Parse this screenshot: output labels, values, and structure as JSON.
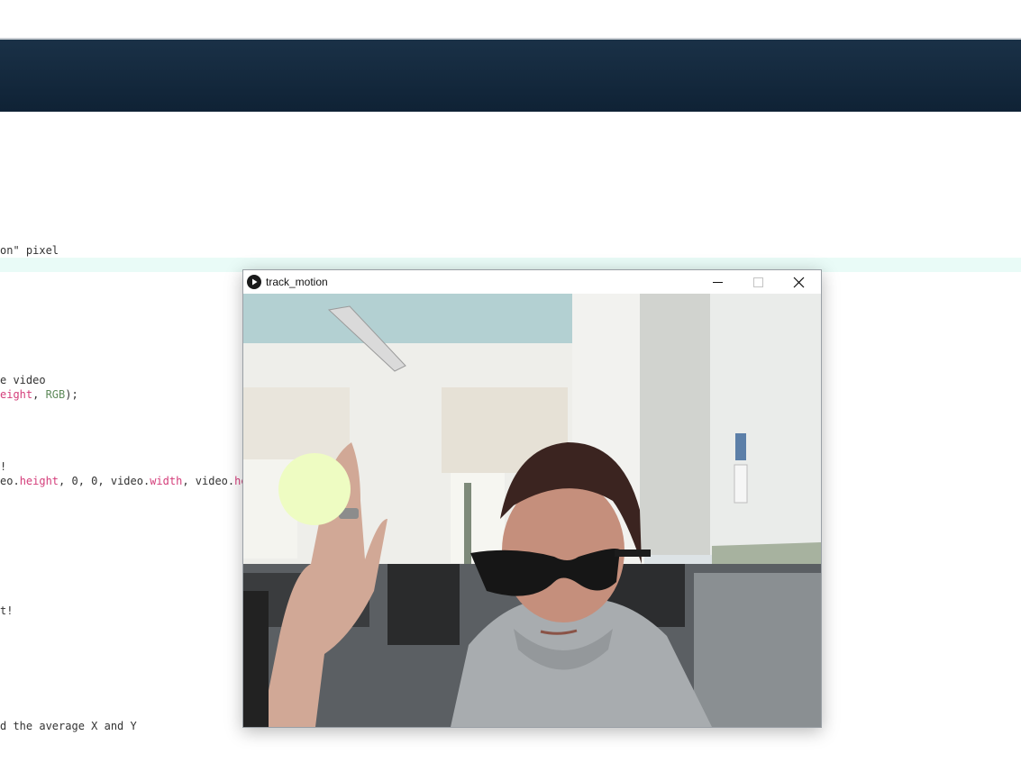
{
  "code_lines": [
    {
      "text_a": "on\" pixel"
    },
    {
      "text_a": "e video"
    },
    {
      "text_a": "",
      "kw_a": "eight",
      "text_b": ", ",
      "const_a": "RGB",
      "text_c": ");"
    },
    {
      "text_a": "!"
    },
    {
      "text_a": "eo.",
      "kw_a": "height",
      "text_b": ", 0, 0, video.",
      "kw_b": "width",
      "text_c": ", video.",
      "kw_c": "hei"
    },
    {
      "text_a": "t!"
    },
    {
      "text_a": "d the average X and Y"
    }
  ],
  "sketch_window": {
    "title": "track_motion",
    "controls": [
      "minimize",
      "maximize",
      "close"
    ]
  },
  "canvas": {
    "tracked_point_color": "#eefcc2",
    "content": "webcam feed: person wearing sunglasses raising hand in classroom"
  },
  "colors": {
    "header_bar": "#12283c",
    "keyword": "#d43d7a",
    "constant": "#5e8a5a",
    "line_highlight": "#e9fbf7"
  }
}
